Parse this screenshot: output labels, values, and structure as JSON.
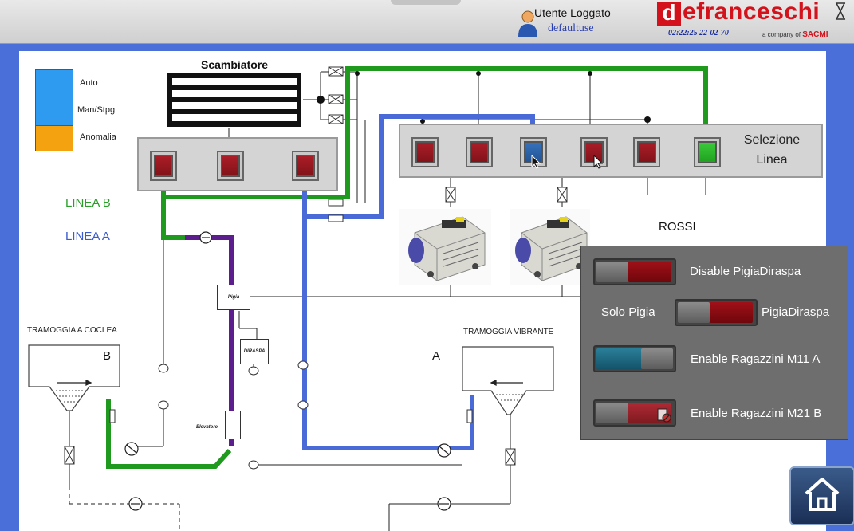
{
  "header": {
    "user_label": "Utente Loggato",
    "user_name": "defaultuse",
    "brand_first": "d",
    "brand_rest": "efranceschi",
    "clock": "02:22:25 22-02-70",
    "brand_sub": "a company of",
    "brand_parent": "SACMI"
  },
  "legend": {
    "items": [
      {
        "label": "Auto",
        "color": "#2f9bf0"
      },
      {
        "label": "Man/Stpg",
        "color": "#2f9bf0"
      },
      {
        "label": "Anomalia",
        "color": "#f5a210"
      }
    ]
  },
  "lines": {
    "line_b": "LINEA B",
    "line_a": "LINEA A",
    "green": "#1f9a1f",
    "blue": "#4a6ad8",
    "purple": "#5b1e8c"
  },
  "exchanger": {
    "title": "Scambiatore"
  },
  "selection": {
    "label": "Selezione Linea"
  },
  "rossi": "ROSSI",
  "hoppers": {
    "coclea": "TRAMOGGIA A COCLEA",
    "vibrante": "TRAMOGGIA VIBRANTE",
    "letter_b": "B",
    "letter_a": "A"
  },
  "boxes": {
    "pigia": "Pigia",
    "diraspa": "DIRASPA",
    "elevatore": "Elevatore"
  },
  "controls": {
    "disable_pigiadiraspa": "Disable PigiaDiraspa",
    "solo_pigia": "Solo Pigia",
    "pigiadiraspa": "PigiaDiraspa",
    "enable_m11a": "Enable Ragazzini M11 A",
    "enable_m21b": "Enable Ragazzini M21 B",
    "toggle_colors": {
      "off": "#8b0c12",
      "on": "#1f6a80"
    }
  },
  "icons": {
    "user": "user-icon",
    "hourglass": "hourglass-icon",
    "home": "home-icon"
  }
}
